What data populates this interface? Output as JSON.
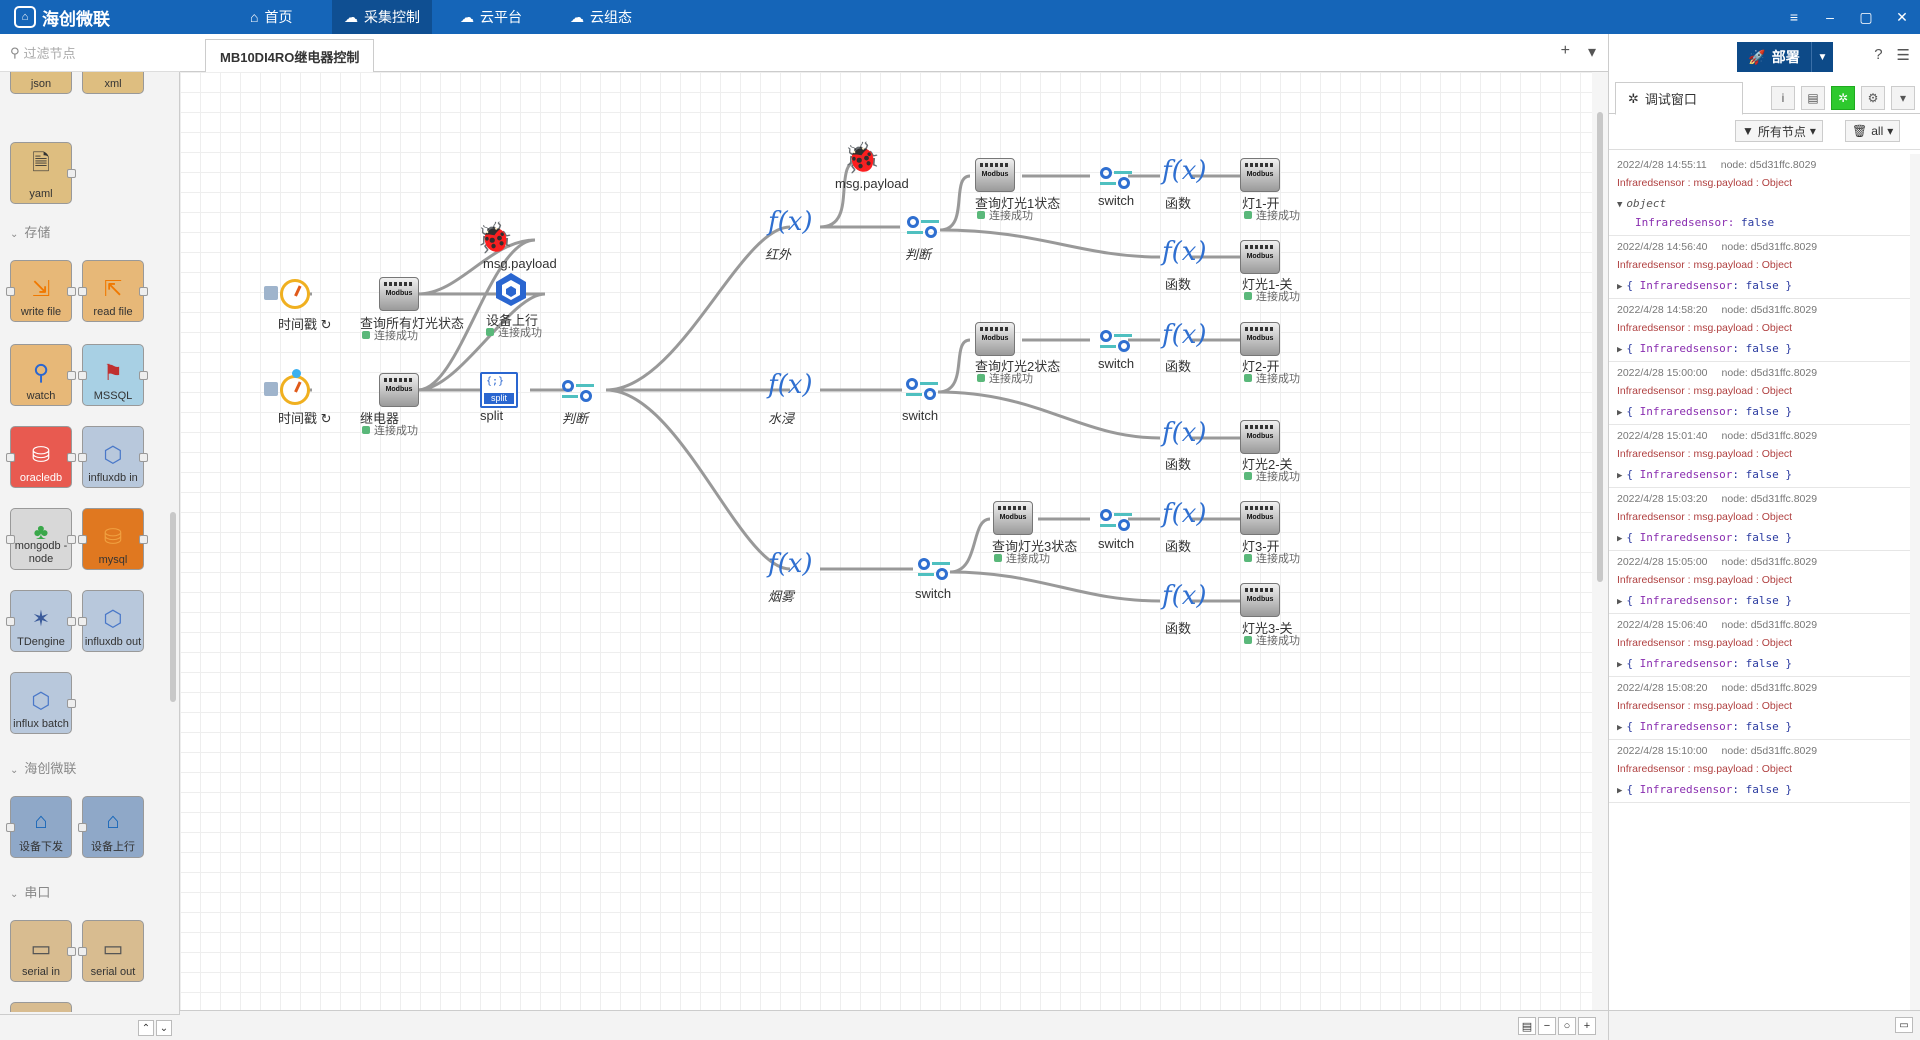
{
  "app": {
    "brand": "海创微联"
  },
  "topnav": [
    {
      "label": "首页",
      "icon": "home-icon"
    },
    {
      "label": "采集控制",
      "icon": "cloud-gear-icon"
    },
    {
      "label": "云平台",
      "icon": "cloud-icon"
    },
    {
      "label": "云组态",
      "icon": "cloud-config-icon"
    }
  ],
  "palette": {
    "filter_placeholder": "过滤节点",
    "top_partial": [
      "json",
      "xml"
    ],
    "yaml": "yaml",
    "categories": {
      "storage": "存储",
      "haichuang": "海创微联",
      "serial": "串口"
    },
    "storage_nodes": [
      "write file",
      "read file",
      "watch",
      "MSSQL",
      "oracledb",
      "influxdb in",
      "mongodb - node",
      "mysql",
      "TDengine",
      "influxdb out",
      "influx batch"
    ],
    "haichuang_nodes": [
      "设备下发",
      "设备上行"
    ],
    "serial_nodes": [
      "serial in",
      "serial out"
    ]
  },
  "workspace": {
    "tab_label": "MB10DI4RO继电器控制",
    "nodes": {
      "timer1": "时间戳 ↻",
      "timer2": "时间戳 ↻",
      "modbus_all": "查询所有灯光状态",
      "relay": "继电器",
      "debug1": "msg.payload",
      "up": "设备上行",
      "split": "split",
      "judge_main": "判断",
      "fn_infrared": "红外",
      "debug2": "msg.payload",
      "judge_top": "判断",
      "q1": "查询灯光1状态",
      "sw1": "switch",
      "fn1a": "函数",
      "light1_on": "灯1-开",
      "fn1b": "函数",
      "light1_off": "灯光1-关",
      "fn_water": "水浸",
      "sw_mid": "switch",
      "q2": "查询灯光2状态",
      "sw2": "switch",
      "fn2a": "函数",
      "light2_on": "灯2-开",
      "fn2b": "函数",
      "light2_off": "灯光2-关",
      "fn_smoke": "烟雾",
      "sw_bot": "switch",
      "q3": "查询灯光3状态",
      "sw3": "switch",
      "fn3a": "函数",
      "light3_on": "灯3-开",
      "fn3b": "函数",
      "light3_off": "灯光3-关"
    },
    "status_text": "连接成功",
    "modbus_text": "Modbus"
  },
  "sidebar": {
    "deploy_label": "部署",
    "tab_label": "调试窗口",
    "filter_nodes": "所有节点",
    "filter_all": "all",
    "messages": [
      {
        "time": "2022/4/28 14:55:11",
        "node": "node: d5d31ffc.8029",
        "topic": "Infraredsensor : msg.payload : Object",
        "expanded": true,
        "obj": "object",
        "key": "Infraredsensor",
        "value": "false"
      },
      {
        "time": "2022/4/28 14:56:40",
        "node": "node: d5d31ffc.8029",
        "topic": "Infraredsensor : msg.payload : Object",
        "summary_key": "Infraredsensor",
        "summary_val": "false"
      },
      {
        "time": "2022/4/28 14:58:20",
        "node": "node: d5d31ffc.8029",
        "topic": "Infraredsensor : msg.payload : Object",
        "summary_key": "Infraredsensor",
        "summary_val": "false"
      },
      {
        "time": "2022/4/28 15:00:00",
        "node": "node: d5d31ffc.8029",
        "topic": "Infraredsensor : msg.payload : Object",
        "summary_key": "Infraredsensor",
        "summary_val": "false"
      },
      {
        "time": "2022/4/28 15:01:40",
        "node": "node: d5d31ffc.8029",
        "topic": "Infraredsensor : msg.payload : Object",
        "summary_key": "Infraredsensor",
        "summary_val": "false"
      },
      {
        "time": "2022/4/28 15:03:20",
        "node": "node: d5d31ffc.8029",
        "topic": "Infraredsensor : msg.payload : Object",
        "summary_key": "Infraredsensor",
        "summary_val": "false"
      },
      {
        "time": "2022/4/28 15:05:00",
        "node": "node: d5d31ffc.8029",
        "topic": "Infraredsensor : msg.payload : Object",
        "summary_key": "Infraredsensor",
        "summary_val": "false"
      },
      {
        "time": "2022/4/28 15:06:40",
        "node": "node: d5d31ffc.8029",
        "topic": "Infraredsensor : msg.payload : Object",
        "summary_key": "Infraredsensor",
        "summary_val": "false"
      },
      {
        "time": "2022/4/28 15:08:20",
        "node": "node: d5d31ffc.8029",
        "topic": "Infraredsensor : msg.payload : Object",
        "summary_key": "Infraredsensor",
        "summary_val": "false"
      },
      {
        "time": "2022/4/28 15:10:00",
        "node": "node: d5d31ffc.8029",
        "topic": "Infraredsensor : msg.payload : Object",
        "summary_key": "Infraredsensor",
        "summary_val": "false"
      }
    ]
  },
  "colors": {
    "topbar": "#1565b8",
    "deploy": "#0d4a88",
    "fx": "#2f6fd0",
    "status_ok": "#5ab87a"
  }
}
